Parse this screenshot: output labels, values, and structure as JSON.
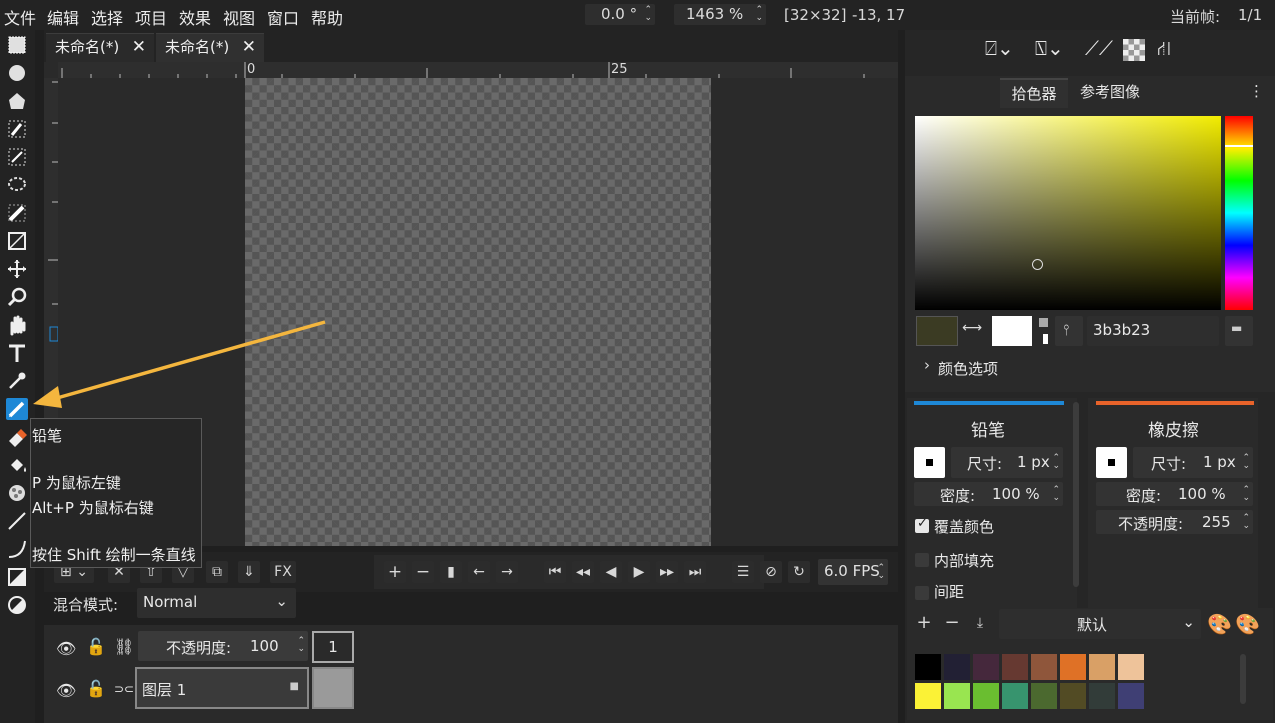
{
  "menu": [
    "文件",
    "编辑",
    "选择",
    "项目",
    "效果",
    "视图",
    "窗口",
    "帮助"
  ],
  "top": {
    "rotation": "0.0 °",
    "zoom": "1463 %",
    "canvas_size": "[32×32]",
    "cursor_pos": "-13, 17",
    "frame_label": "当前帧:",
    "frame_value": "1/1"
  },
  "tabs": [
    {
      "label": "未命名(*)",
      "close": "✕"
    },
    {
      "label": "未命名(*)",
      "close": "✕"
    }
  ],
  "ruler": {
    "mark0": "0",
    "mark25": "25"
  },
  "tooltip": {
    "title": "铅笔",
    "line1": "P 为鼠标左键",
    "line2": "Alt+P 为鼠标右键",
    "line3": "按住 Shift 绘制一条直线"
  },
  "animation": {
    "fx": "FX",
    "fps": "6.0 FPS",
    "blend_label": "混合模式:",
    "blend_value": "Normal"
  },
  "layers": {
    "opacity_label": "不透明度:",
    "opacity_value": "100",
    "frame_number": "1",
    "layer_name": "图层 1"
  },
  "color_panel": {
    "tab_picker": "拾色器",
    "tab_reference": "参考图像",
    "hex": "3b3b23",
    "current_color": "#3b3b23",
    "secondary_color": "#ffffff",
    "options_label": "颜色选项"
  },
  "pencil": {
    "title": "铅笔",
    "size_label": "尺寸:",
    "size_value": "1 px",
    "density_label": "密度:",
    "density_value": "100 %",
    "overwrite_label": "覆盖颜色",
    "fill_inside_label": "内部填充",
    "spacing_label": "间距",
    "accent": "#1e88d6"
  },
  "eraser": {
    "title": "橡皮擦",
    "size_label": "尺寸:",
    "size_value": "1 px",
    "density_label": "密度:",
    "density_value": "100 %",
    "opacity_label": "不透明度:",
    "opacity_value": "255",
    "accent": "#e8632a"
  },
  "palette": {
    "name": "默认",
    "colors_row1": [
      "#000000",
      "#222034",
      "#45283c",
      "#663931",
      "#8f563b",
      "#df7126",
      "#d9a066",
      "#eec39a"
    ],
    "colors_row2": [
      "#fbf236",
      "#99e550",
      "#6abe30",
      "#37946e",
      "#4b692f",
      "#524b24",
      "#323c39",
      "#3f3f74"
    ]
  },
  "arrow_color": "#f4b63e"
}
